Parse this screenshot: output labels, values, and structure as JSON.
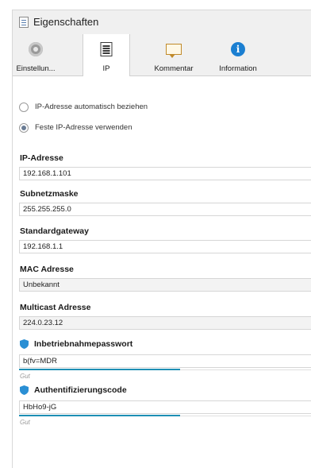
{
  "window": {
    "title": "Eigenschaften"
  },
  "tabs": [
    {
      "label": "Einstellun...",
      "icon": "gear-icon"
    },
    {
      "label": "IP",
      "icon": "document-list-icon"
    },
    {
      "label": "Kommentar",
      "icon": "comment-icon"
    },
    {
      "label": "Information",
      "icon": "info-icon"
    }
  ],
  "active_tab": "IP",
  "ip_mode": {
    "auto_label": "IP-Adresse automatisch beziehen",
    "fixed_label": "Feste IP-Adresse verwenden",
    "selected": "fixed"
  },
  "fields": {
    "ip_address": {
      "label": "IP-Adresse",
      "value": "192.168.1.101"
    },
    "subnet_mask": {
      "label": "Subnetzmaske",
      "value": "255.255.255.0"
    },
    "gateway": {
      "label": "Standardgateway",
      "value": "192.168.1.1"
    },
    "mac": {
      "label": "MAC Adresse",
      "value": "Unbekannt"
    },
    "multicast": {
      "label": "Multicast Adresse",
      "value": "224.0.23.12"
    },
    "commissioning_password": {
      "label": "Inbetriebnahmepasswort",
      "value": "b(fv=MDR",
      "strength_text": "Gut",
      "strength_fraction": 0.55
    },
    "auth_code": {
      "label": "Authentifizierungscode",
      "value": "HbHo9-jG",
      "strength_text": "Gut",
      "strength_fraction": 0.55
    }
  },
  "colors": {
    "accent": "#1e8fb4",
    "shield": "#2a8fd4",
    "info": "#1b7fd1"
  }
}
